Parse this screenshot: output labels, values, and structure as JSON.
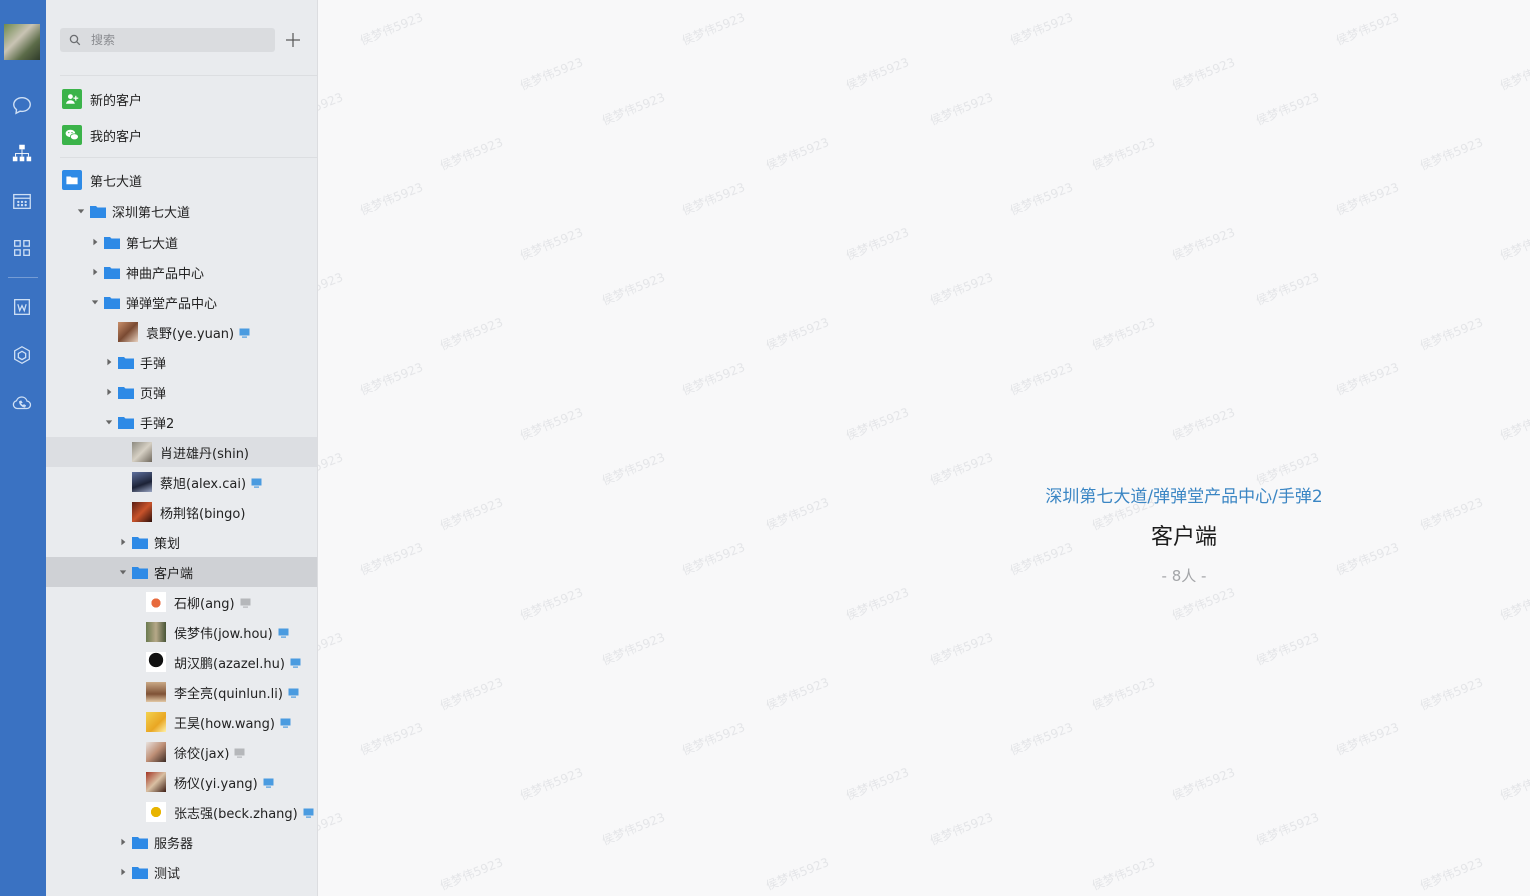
{
  "search": {
    "placeholder": "搜索"
  },
  "quick": [
    {
      "label": "新的客户"
    },
    {
      "label": "我的客户"
    }
  ],
  "org": {
    "root": "第七大道",
    "tree": [
      {
        "label": "深圳第七大道",
        "kind": "folder",
        "level": 1,
        "expanded": true
      },
      {
        "label": "第七大道",
        "kind": "folder",
        "level": 2,
        "expanded": false
      },
      {
        "label": "神曲产品中心",
        "kind": "folder",
        "level": 2,
        "expanded": false
      },
      {
        "label": "弹弹堂产品中心",
        "kind": "folder",
        "level": 2,
        "expanded": true
      },
      {
        "label": "袁野(ye.yuan)",
        "kind": "person",
        "level": 3,
        "device": "online"
      },
      {
        "label": "手弹",
        "kind": "folder",
        "level": 3,
        "expanded": false
      },
      {
        "label": "页弹",
        "kind": "folder",
        "level": 3,
        "expanded": false
      },
      {
        "label": "手弹2",
        "kind": "folder",
        "level": 3,
        "expanded": true
      },
      {
        "label": "肖进雄丹(shin)",
        "kind": "person",
        "level": 4,
        "device": "none",
        "state": "hover"
      },
      {
        "label": "蔡旭(alex.cai)",
        "kind": "person",
        "level": 4,
        "device": "online"
      },
      {
        "label": "杨荆铭(bingo)",
        "kind": "person",
        "level": 4,
        "device": "none"
      },
      {
        "label": "策划",
        "kind": "folder",
        "level": 4,
        "expanded": false
      },
      {
        "label": "客户端",
        "kind": "folder",
        "level": 4,
        "expanded": true,
        "state": "selected"
      },
      {
        "label": "石柳(ang)",
        "kind": "person",
        "level": 5,
        "device": "offline"
      },
      {
        "label": "侯梦伟(jow.hou)",
        "kind": "person",
        "level": 5,
        "device": "online"
      },
      {
        "label": "胡汉鹏(azazel.hu)",
        "kind": "person",
        "level": 5,
        "device": "online"
      },
      {
        "label": "李全亮(quinlun.li)",
        "kind": "person",
        "level": 5,
        "device": "online"
      },
      {
        "label": "王昊(how.wang)",
        "kind": "person",
        "level": 5,
        "device": "online"
      },
      {
        "label": "徐佼(jax)",
        "kind": "person",
        "level": 5,
        "device": "offline"
      },
      {
        "label": "杨仪(yi.yang)",
        "kind": "person",
        "level": 5,
        "device": "online"
      },
      {
        "label": "张志强(beck.zhang)",
        "kind": "person",
        "level": 5,
        "device": "online"
      },
      {
        "label": "服务器",
        "kind": "folder",
        "level": 4,
        "expanded": false
      },
      {
        "label": "测试",
        "kind": "folder",
        "level": 4,
        "expanded": false
      }
    ]
  },
  "detail": {
    "path": "深圳第七大道/弹弹堂产品中心/手弹2",
    "title": "客户端",
    "count": "- 8人 -"
  },
  "watermark": "侯梦伟5923",
  "colors": {
    "rail": "#3a72c2",
    "accent_link": "#3b86c4",
    "folder": "#2e8ae6",
    "green_badge": "#3bb34a",
    "device_online": "#4a9be0",
    "device_offline": "#b5b7ba"
  },
  "icons": {
    "rail": [
      "chat-icon",
      "org-chart-icon",
      "calendar-icon",
      "apps-grid-icon",
      "doc-w-icon",
      "cube-icon",
      "cloud-phone-icon"
    ]
  }
}
